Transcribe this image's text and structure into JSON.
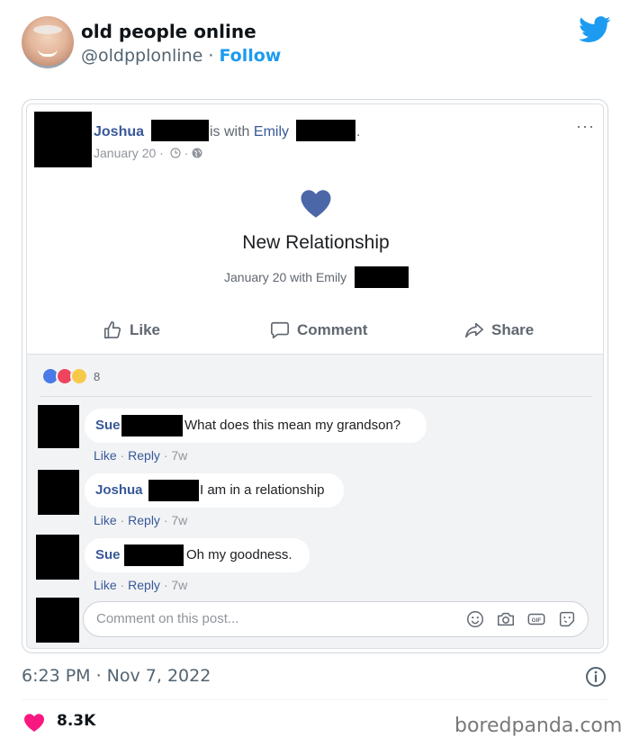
{
  "tweet": {
    "display_name": "old people online",
    "handle": "@oldpplonline",
    "separator": "·",
    "follow_label": "Follow",
    "timestamp": "6:23 PM · Nov 7, 2022",
    "like_count": "8.3K",
    "accent_color": "#1d9bf0"
  },
  "fb_post": {
    "author": "Joshua",
    "with_text": "is with",
    "with_name": "Emily",
    "period": ".",
    "date": "January 20 ·",
    "more_label": "···",
    "event_title": "New Relationship",
    "event_sub": "January 20 with Emily",
    "actions": {
      "like": "Like",
      "comment": "Comment",
      "share": "Share"
    },
    "reaction_count": "8",
    "comments": [
      {
        "name": "Sue",
        "text": "What does this mean my grandson?",
        "like": "Like",
        "reply": "Reply",
        "age": "7w"
      },
      {
        "name": "Joshua",
        "text": "I am in a relationship",
        "like": "Like",
        "reply": "Reply",
        "age": "7w"
      },
      {
        "name": "Sue",
        "text": "Oh my goodness.",
        "like": "Like",
        "reply": "Reply",
        "age": "7w"
      }
    ],
    "comment_placeholder": "Comment on this post...",
    "fb_blue": "#385898",
    "heart_color": "#4b67a8"
  },
  "watermark": "boredpanda.com",
  "icons": [
    "twitter-bird-icon",
    "clock-icon",
    "globe-icon",
    "heart-icon",
    "thumbs-up-icon",
    "comment-icon",
    "share-icon",
    "emoji-icon",
    "camera-icon",
    "gif-icon",
    "sticker-icon",
    "info-icon",
    "like-heart-icon"
  ]
}
